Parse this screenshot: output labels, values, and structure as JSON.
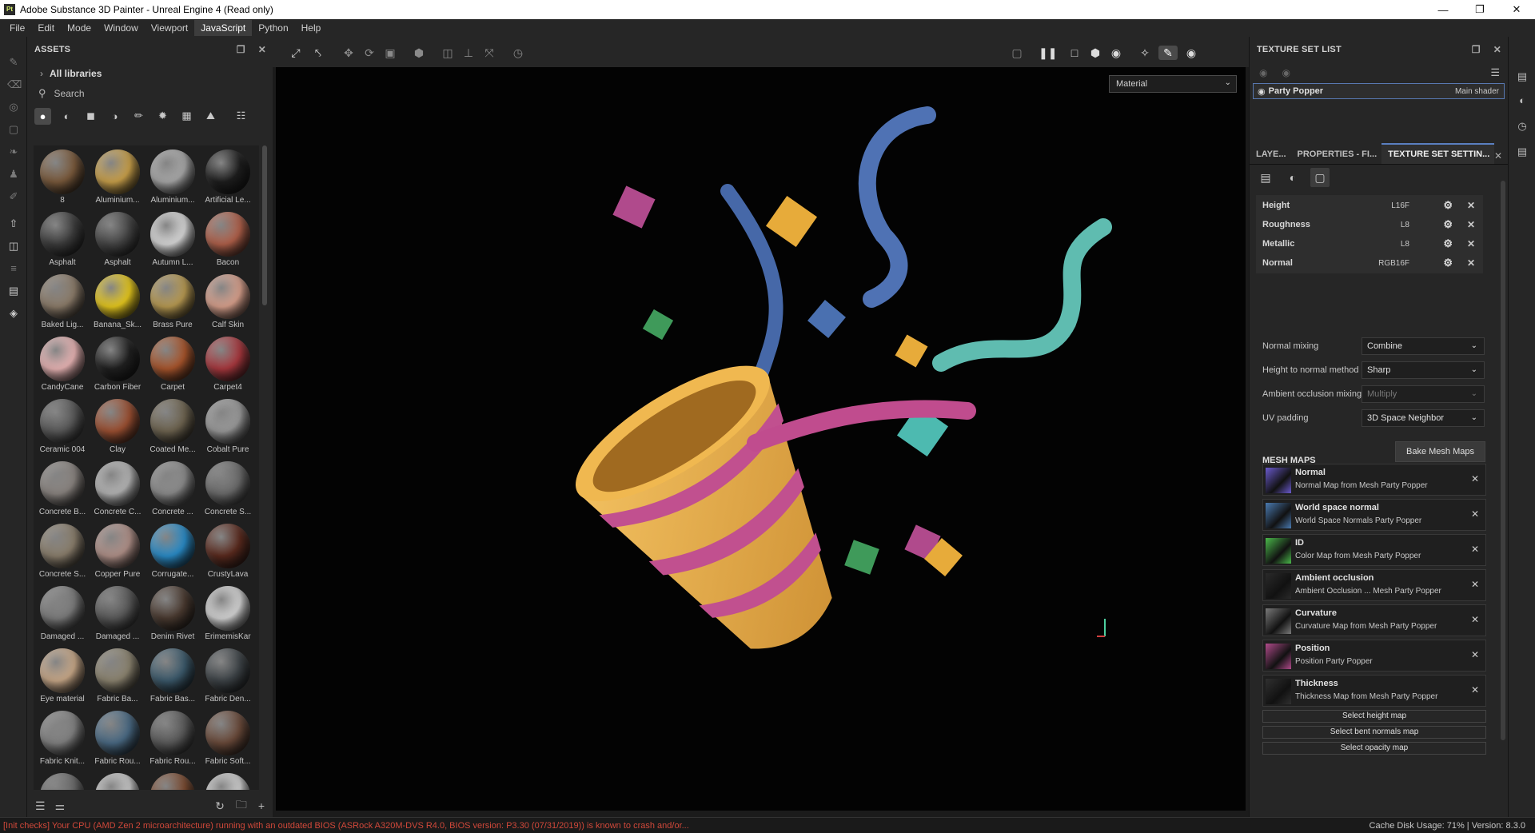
{
  "window": {
    "title": "Adobe Substance 3D Painter - Unreal Engine 4 (Read only)",
    "logo": "Pt"
  },
  "menu": [
    "File",
    "Edit",
    "Mode",
    "Window",
    "Viewport",
    "JavaScript",
    "Python",
    "Help"
  ],
  "menu_active": "JavaScript",
  "assets": {
    "title": "ASSETS",
    "libraries": "All libraries",
    "search_placeholder": "Search",
    "items": [
      {
        "label": "8",
        "color": "#7a5a3c"
      },
      {
        "label": "Aluminium...",
        "color": "#c9a04a"
      },
      {
        "label": "Aluminium...",
        "color": "#a8a8a8"
      },
      {
        "label": "Artificial Le...",
        "color": "#1e1e1e"
      },
      {
        "label": "Asphalt",
        "color": "#3c3c3c"
      },
      {
        "label": "Asphalt",
        "color": "#454545"
      },
      {
        "label": "Autumn L...",
        "color": "#d8d8d8"
      },
      {
        "label": "Bacon",
        "color": "#b0604a"
      },
      {
        "label": "Baked Lig...",
        "color": "#8c7c6a"
      },
      {
        "label": "Banana_Sk...",
        "color": "#e6c81e"
      },
      {
        "label": "Brass Pure",
        "color": "#b89a52"
      },
      {
        "label": "Calf Skin",
        "color": "#d8a08c"
      },
      {
        "label": "CandyCane",
        "color": "#e8b4b4"
      },
      {
        "label": "Carbon Fiber",
        "color": "#202020"
      },
      {
        "label": "Carpet",
        "color": "#a8552c"
      },
      {
        "label": "Carpet4",
        "color": "#a8383e"
      },
      {
        "label": "Ceramic 004",
        "color": "#5a5a5a"
      },
      {
        "label": "Clay",
        "color": "#9c5032"
      },
      {
        "label": "Coated Me...",
        "color": "#6e6450"
      },
      {
        "label": "Cobalt Pure",
        "color": "#9a9a9a"
      },
      {
        "label": "Concrete B...",
        "color": "#8a8480"
      },
      {
        "label": "Concrete C...",
        "color": "#b4b4b4"
      },
      {
        "label": "Concrete ...",
        "color": "#8c8c8c"
      },
      {
        "label": "Concrete S...",
        "color": "#6c6c6c"
      },
      {
        "label": "Concrete S...",
        "color": "#8a7e6c"
      },
      {
        "label": "Copper Pure",
        "color": "#b09088"
      },
      {
        "label": "Corrugate...",
        "color": "#2a8cc8"
      },
      {
        "label": "CrustyLava",
        "color": "#5a2a1e"
      },
      {
        "label": "Damaged ...",
        "color": "#7c7c7c"
      },
      {
        "label": "Damaged ...",
        "color": "#5a5a5a"
      },
      {
        "label": "Denim Rivet",
        "color": "#4a3a30"
      },
      {
        "label": "ErimemisKar",
        "color": "#d4d4d4"
      },
      {
        "label": "Eye material",
        "color": "#c8a888"
      },
      {
        "label": "Fabric Ba...",
        "color": "#8c8470"
      },
      {
        "label": "Fabric Bas...",
        "color": "#3c5a6c"
      },
      {
        "label": "Fabric Den...",
        "color": "#3e4448"
      },
      {
        "label": "Fabric Knit...",
        "color": "#828282"
      },
      {
        "label": "Fabric Rou...",
        "color": "#4a6a84"
      },
      {
        "label": "Fabric Rou...",
        "color": "#5a5a5a"
      },
      {
        "label": "Fabric Soft...",
        "color": "#6a4a3a"
      },
      {
        "label": "",
        "color": "#6a6a6a"
      },
      {
        "label": "",
        "color": "#c8c8c8"
      },
      {
        "label": "",
        "color": "#7a4a30"
      },
      {
        "label": "",
        "color": "#d0d0d0"
      }
    ]
  },
  "viewport": {
    "mode": "Material"
  },
  "texture_set_list": {
    "title": "TEXTURE SET LIST",
    "item": "Party Popper",
    "shader": "Main shader"
  },
  "tabs": [
    "LAYE...",
    "PROPERTIES - FI...",
    "TEXTURE SET SETTIN..."
  ],
  "channels": [
    {
      "name": "Height",
      "format": "L16F"
    },
    {
      "name": "Roughness",
      "format": "L8"
    },
    {
      "name": "Metallic",
      "format": "L8"
    },
    {
      "name": "Normal",
      "format": "RGB16F"
    }
  ],
  "settings": [
    {
      "label": "Normal mixing",
      "value": "Combine",
      "disabled": false
    },
    {
      "label": "Height to normal method",
      "value": "Sharp",
      "disabled": false
    },
    {
      "label": "Ambient occlusion mixing",
      "value": "Multiply",
      "disabled": true
    },
    {
      "label": "UV padding",
      "value": "3D Space Neighbor",
      "disabled": false
    }
  ],
  "mesh_maps_title": "MESH MAPS",
  "bake_button": "Bake Mesh Maps",
  "mesh_maps": [
    {
      "name": "Normal",
      "desc": "Normal Map from Mesh Party Popper",
      "color": "#6a5acd"
    },
    {
      "name": "World space normal",
      "desc": "World Space Normals Party Popper",
      "color": "#4a7ab0"
    },
    {
      "name": "ID",
      "desc": "Color Map from Mesh Party Popper",
      "color": "#4ab84a"
    },
    {
      "name": "Ambient occlusion",
      "desc": "Ambient Occlusion ... Mesh Party Popper",
      "color": "#2a2a2a"
    },
    {
      "name": "Curvature",
      "desc": "Curvature Map from Mesh Party Popper",
      "color": "#7a7a7a"
    },
    {
      "name": "Position",
      "desc": "Position Party Popper",
      "color": "#b04a8a"
    },
    {
      "name": "Thickness",
      "desc": "Thickness Map from Mesh Party Popper",
      "color": "#303030"
    }
  ],
  "select_maps": [
    "Select height map",
    "Select bent normals map",
    "Select opacity map"
  ],
  "status": {
    "error": "[Init checks] Your CPU (AMD Zen 2 microarchitecture) running with an outdated BIOS (ASRock A320M-DVS R4.0, BIOS version: P3.30 (07/31/2019)) is known to crash and/or...",
    "right": "Cache Disk Usage:   71% | Version: 8.3.0"
  },
  "icons": {
    "close": "close-icon",
    "gear": "gear-icon",
    "eye": "eye-icon"
  }
}
